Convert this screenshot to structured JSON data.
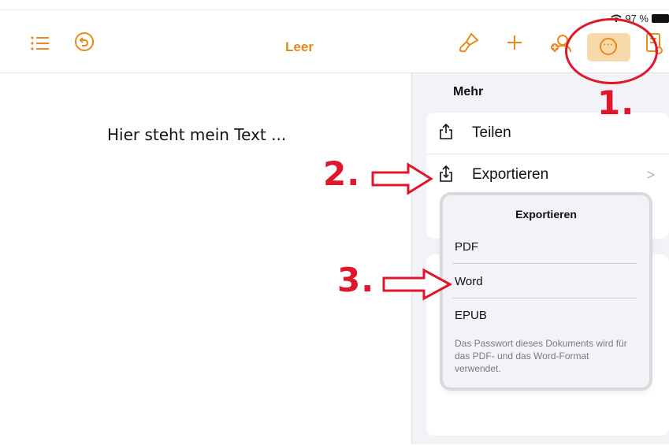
{
  "status_bar": {
    "battery_text": "97 %"
  },
  "toolbar": {
    "title": "Leer",
    "icons": [
      "list-icon",
      "undo-icon",
      "paintbrush-icon",
      "plus-icon",
      "collaborate-icon",
      "more-icon",
      "document-icon"
    ]
  },
  "document": {
    "text": "Hier steht mein Text ..."
  },
  "more_panel": {
    "title": "Mehr",
    "items": [
      {
        "label": "Teilen",
        "icon": "share-icon"
      },
      {
        "label": "Exportieren",
        "icon": "export-icon",
        "chevron": ">"
      }
    ]
  },
  "export_popup": {
    "title": "Exportieren",
    "options": [
      "PDF",
      "Word",
      "EPUB"
    ],
    "note": "Das Passwort dieses Dokuments wird für das PDF- und das Word-Format verwendet."
  },
  "annotations": {
    "step1": "1.",
    "step2": "2.",
    "step3": "3."
  },
  "colors": {
    "accent": "#e98a1c",
    "highlight": "#f8d9aa",
    "annotation_red": "#e0162b"
  }
}
